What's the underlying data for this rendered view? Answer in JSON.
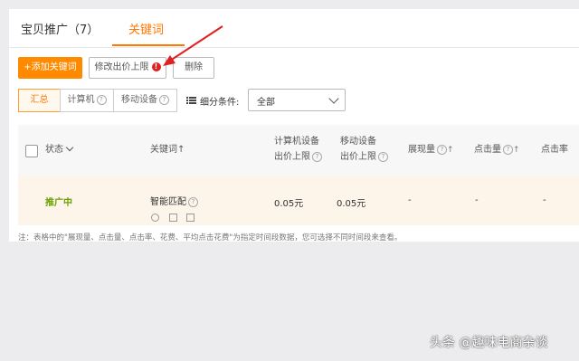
{
  "tabs": [
    {
      "label": "宝贝推广（7）"
    },
    {
      "label": "关键词"
    }
  ],
  "toolbar": {
    "add_label": "+添加关键词",
    "bid_limit_label": "修改出价上限",
    "bid_limit_badge": "!",
    "delete_label": "删除"
  },
  "segments": [
    {
      "label": "汇总"
    },
    {
      "label": "计算机"
    },
    {
      "label": "移动设备"
    }
  ],
  "filter": {
    "label": "细分条件:",
    "value": "全部"
  },
  "table": {
    "headers": {
      "status": "状态",
      "keyword": "关键词↑",
      "pc_bid_line1": "计算机设备",
      "pc_bid_line2": "出价上限",
      "mobile_bid_line1": "移动设备",
      "mobile_bid_line2": "出价上限",
      "impressions": "展现量",
      "clicks": "点击量",
      "ctr": "点击率"
    },
    "rows": [
      {
        "status": "推广中",
        "keyword": "智能匹配",
        "pc_bid": "0.05元",
        "mobile_bid": "0.05元",
        "impressions": "-",
        "clicks": "-",
        "ctr": "-"
      }
    ]
  },
  "note": "注：表格中的\"展现量、点击量、点击率、花费、平均点击花费\"为指定时间段数据，您可选择不同时间段来查看。",
  "watermark": "头条 @趣味电商杂谈",
  "colors": {
    "accent": "#ff7700",
    "status_active": "#6aa100",
    "annotation_arrow": "#e02020"
  }
}
